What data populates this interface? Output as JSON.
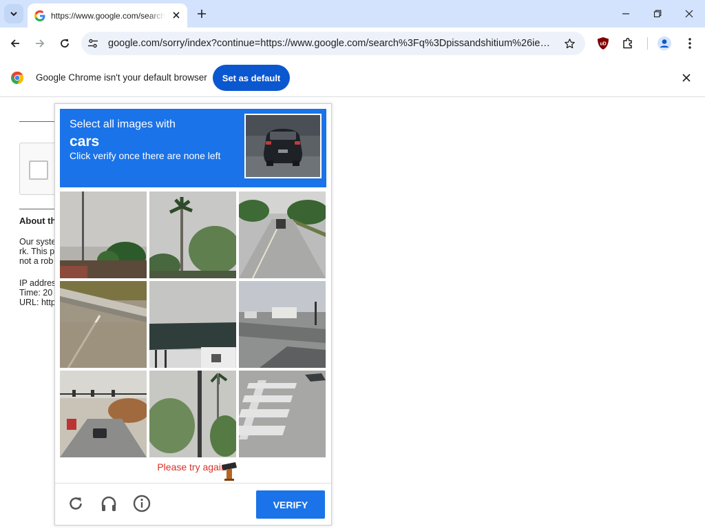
{
  "browser": {
    "tab": {
      "title": "https://www.google.com/search"
    },
    "address": {
      "url": "google.com/sorry/index?continue=https://www.google.com/search%3Fq%3Dpissandshitium%26ie%3D..."
    },
    "infobar": {
      "message": "Google Chrome isn't your default browser",
      "button": "Set as default"
    }
  },
  "page": {
    "about_heading": "About th",
    "lines": [
      "Our syste",
      "rk. This p",
      "not a rob",
      "IP addres",
      "Time: 20",
      "URL: http"
    ]
  },
  "captcha": {
    "instruction_line1": "Select all images with",
    "target": "cars",
    "instruction_line3": "Click verify once there are none left",
    "error": "Please try again.",
    "verify_label": "VERIFY",
    "header_color": "#1a73e8",
    "tiles": [
      {
        "label": "pole-trees"
      },
      {
        "label": "palm-tree"
      },
      {
        "label": "road-car"
      },
      {
        "label": "guardrail"
      },
      {
        "label": "bus-stop-roof"
      },
      {
        "label": "intersection-rv"
      },
      {
        "label": "traffic-lights-car"
      },
      {
        "label": "trees-pole"
      },
      {
        "label": "crosswalk"
      }
    ]
  },
  "icons": [
    "tab-search-icon",
    "google-favicon",
    "close-icon",
    "new-tab-icon",
    "minimize-icon",
    "restore-icon",
    "back-icon",
    "forward-icon",
    "reload-icon",
    "site-settings-icon",
    "star-icon",
    "ublock-icon",
    "extensions-icon",
    "profile-icon",
    "menu-icon",
    "chrome-logo-icon",
    "refresh-icon",
    "headphones-icon",
    "info-icon"
  ]
}
